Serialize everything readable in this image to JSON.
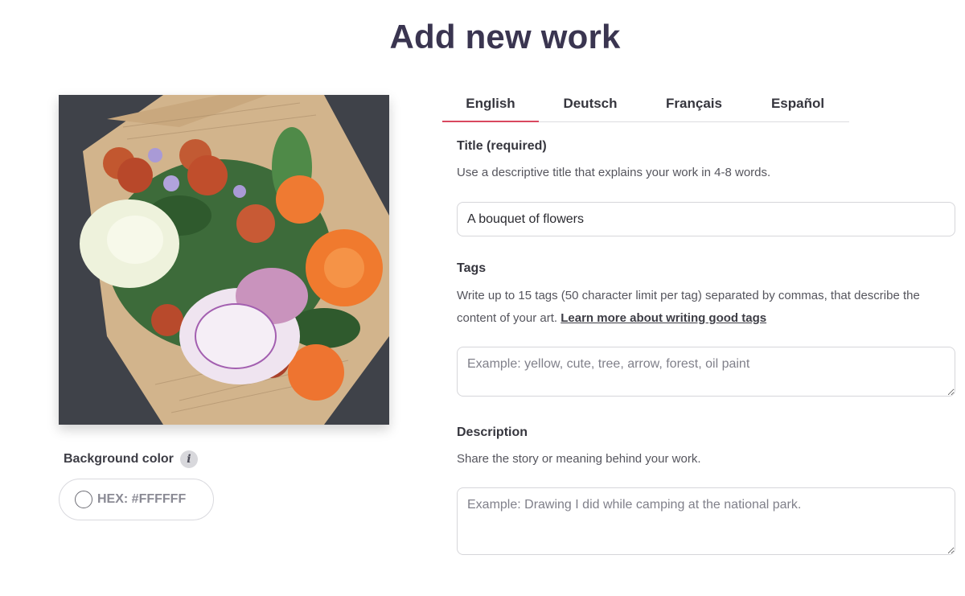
{
  "page": {
    "title": "Add new work"
  },
  "artwork": {
    "alt": "Bouquet of flowers wrapped in newspaper-print paper",
    "background_color": {
      "label": "Background color",
      "info_icon": "info-icon",
      "hex_display": "HEX: #FFFFFF",
      "value": "#FFFFFF"
    }
  },
  "tabs": [
    {
      "label": "English",
      "active": true
    },
    {
      "label": "Deutsch",
      "active": false
    },
    {
      "label": "Français",
      "active": false
    },
    {
      "label": "Español",
      "active": false
    }
  ],
  "form": {
    "title": {
      "label": "Title (required)",
      "help": "Use a descriptive title that explains your work in 4-8 words.",
      "value": "A bouquet of flowers",
      "placeholder": ""
    },
    "tags": {
      "label": "Tags",
      "help": "Write up to 15 tags (50 character limit per tag) separated by commas, that describe the content of your art.",
      "help_link": "Learn more about writing good tags",
      "value": "",
      "placeholder": "Example: yellow, cute, tree, arrow, forest, oil paint"
    },
    "description": {
      "label": "Description",
      "help": "Share the story or meaning behind your work.",
      "value": "",
      "placeholder": "Example: Drawing I did while camping at the national park."
    }
  },
  "colors": {
    "title": "#3a3550",
    "tab_active_underline": "#d9485f",
    "border": "#d6d6da"
  }
}
